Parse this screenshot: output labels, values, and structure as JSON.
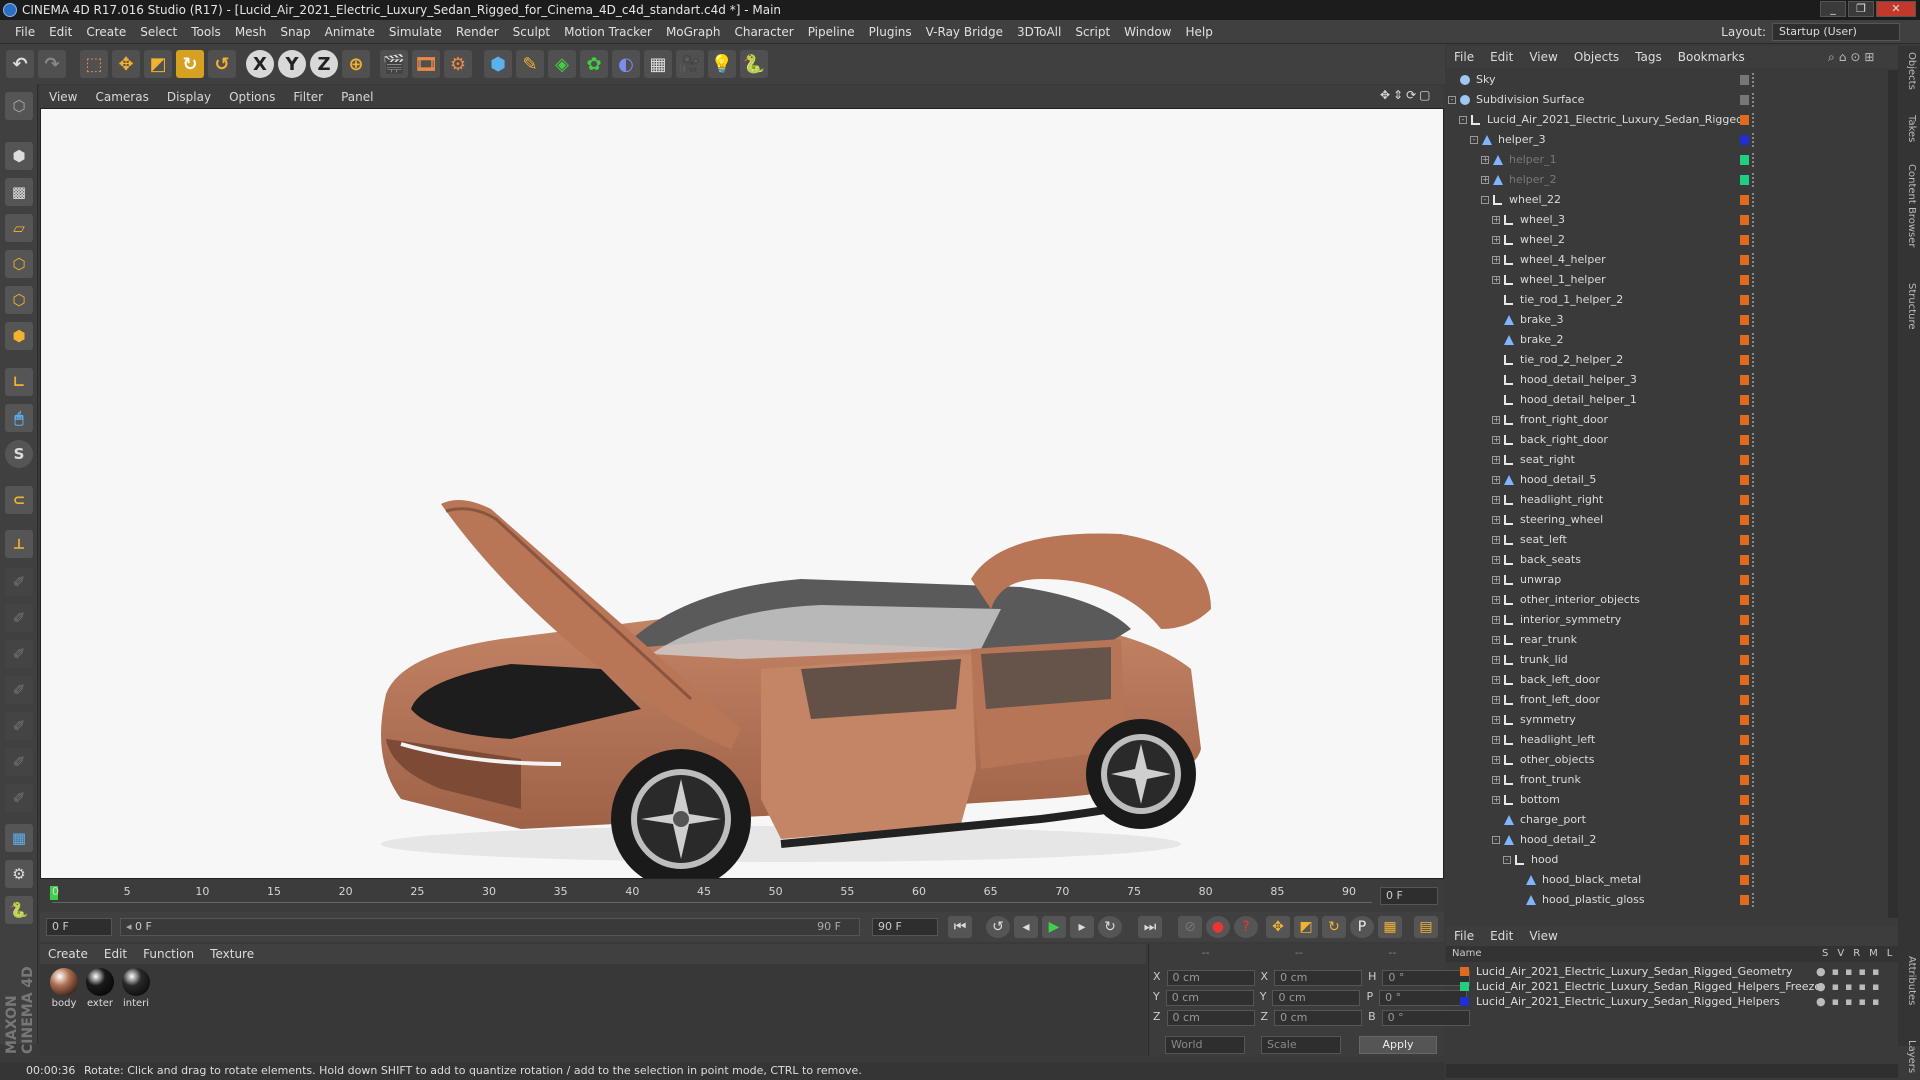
{
  "window": {
    "title": "CINEMA 4D R17.016 Studio (R17) - [Lucid_Air_2021_Electric_Luxury_Sedan_Rigged_for_Cinema_4D_c4d_standart.c4d *] - Main",
    "buttons": [
      "_",
      "❐",
      "✕"
    ]
  },
  "menubar": {
    "items": [
      "File",
      "Edit",
      "Create",
      "Select",
      "Tools",
      "Mesh",
      "Snap",
      "Animate",
      "Simulate",
      "Render",
      "Sculpt",
      "Motion Tracker",
      "MoGraph",
      "Character",
      "Pipeline",
      "Plugins",
      "V-Ray Bridge",
      "3DToAll",
      "Script",
      "Window",
      "Help"
    ],
    "layout_label": "Layout:",
    "layout_value": "Startup (User)"
  },
  "toolbar": {
    "axis_labels": [
      "X",
      "Y",
      "Z"
    ]
  },
  "viewport": {
    "menu": [
      "View",
      "Cameras",
      "Display",
      "Options",
      "Filter",
      "Panel"
    ]
  },
  "timeline": {
    "ticks": [
      "0",
      "5",
      "10",
      "15",
      "20",
      "25",
      "30",
      "35",
      "40",
      "45",
      "50",
      "55",
      "60",
      "65",
      "70",
      "75",
      "80",
      "85",
      "90"
    ],
    "end_frame_field": "0 F",
    "current_frame": "0 F",
    "range_start": "0 F",
    "range_end": "90 F",
    "max_frame": "90 F"
  },
  "materials": {
    "menu": [
      "Create",
      "Edit",
      "Function",
      "Texture"
    ],
    "items": [
      {
        "label": "body",
        "color": "#b07050"
      },
      {
        "label": "exter",
        "color": "#1a1a1a"
      },
      {
        "label": "interi",
        "color": "#2a2a2a"
      }
    ]
  },
  "coordinates": {
    "rows": [
      {
        "a": "X",
        "av": "0 cm",
        "b": "X",
        "bv": "0 cm",
        "c": "H",
        "cv": "0 °"
      },
      {
        "a": "Y",
        "av": "0 cm",
        "b": "Y",
        "bv": "0 cm",
        "c": "P",
        "cv": "0 °"
      },
      {
        "a": "Z",
        "av": "0 cm",
        "b": "Z",
        "bv": "0 cm",
        "c": "B",
        "cv": "0 °"
      }
    ],
    "headers": [
      "--",
      "--",
      "--"
    ],
    "mode1": "World",
    "mode2": "Scale",
    "apply": "Apply"
  },
  "status": {
    "time": "00:00:36",
    "message": "Rotate: Click and drag to rotate elements. Hold down SHIFT to add to quantize rotation / add to the selection in point mode, CTRL to remove."
  },
  "objects_panel": {
    "menu": [
      "File",
      "Edit",
      "View",
      "Objects",
      "Tags",
      "Bookmarks"
    ],
    "rows": [
      {
        "name": "Sky",
        "depth": 0,
        "icon": "sphere",
        "swatch": "#777777"
      },
      {
        "name": "Subdivision Surface",
        "depth": 0,
        "icon": "sphere",
        "swatch": "#777777",
        "exp": "-"
      },
      {
        "name": "Lucid_Air_2021_Electric_Luxury_Sedan_Rigged",
        "depth": 1,
        "icon": "null",
        "swatch": "#e06a20",
        "exp": "-"
      },
      {
        "name": "helper_3",
        "depth": 2,
        "icon": "tri",
        "swatch": "#2030d0",
        "exp": "-"
      },
      {
        "name": "helper_1",
        "depth": 3,
        "icon": "tri",
        "swatch": "#20d080",
        "exp": "+",
        "dim": true
      },
      {
        "name": "helper_2",
        "depth": 3,
        "icon": "tri",
        "swatch": "#20d080",
        "exp": "+",
        "dim": true
      },
      {
        "name": "wheel_22",
        "depth": 3,
        "icon": "null",
        "swatch": "#e06a20",
        "exp": "-"
      },
      {
        "name": "wheel_3",
        "depth": 4,
        "icon": "null",
        "swatch": "#e06a20",
        "exp": "+"
      },
      {
        "name": "wheel_2",
        "depth": 4,
        "icon": "null",
        "swatch": "#e06a20",
        "exp": "+"
      },
      {
        "name": "wheel_4_helper",
        "depth": 4,
        "icon": "null",
        "swatch": "#e06a20",
        "exp": "+"
      },
      {
        "name": "wheel_1_helper",
        "depth": 4,
        "icon": "null",
        "swatch": "#e06a20",
        "exp": "+"
      },
      {
        "name": "tie_rod_1_helper_2",
        "depth": 4,
        "icon": "null",
        "swatch": "#e06a20"
      },
      {
        "name": "brake_3",
        "depth": 4,
        "icon": "tri",
        "swatch": "#e06a20"
      },
      {
        "name": "brake_2",
        "depth": 4,
        "icon": "tri",
        "swatch": "#e06a20"
      },
      {
        "name": "tie_rod_2_helper_2",
        "depth": 4,
        "icon": "null",
        "swatch": "#e06a20"
      },
      {
        "name": "hood_detail_helper_3",
        "depth": 4,
        "icon": "null",
        "swatch": "#e06a20"
      },
      {
        "name": "hood_detail_helper_1",
        "depth": 4,
        "icon": "null",
        "swatch": "#e06a20"
      },
      {
        "name": "front_right_door",
        "depth": 4,
        "icon": "null",
        "swatch": "#e06a20",
        "exp": "+"
      },
      {
        "name": "back_right_door",
        "depth": 4,
        "icon": "null",
        "swatch": "#e06a20",
        "exp": "+"
      },
      {
        "name": "seat_right",
        "depth": 4,
        "icon": "null",
        "swatch": "#e06a20",
        "exp": "+"
      },
      {
        "name": "hood_detail_5",
        "depth": 4,
        "icon": "tri",
        "swatch": "#e06a20",
        "exp": "+"
      },
      {
        "name": "headlight_right",
        "depth": 4,
        "icon": "null",
        "swatch": "#e06a20",
        "exp": "+"
      },
      {
        "name": "steering_wheel",
        "depth": 4,
        "icon": "null",
        "swatch": "#e06a20",
        "exp": "+"
      },
      {
        "name": "seat_left",
        "depth": 4,
        "icon": "null",
        "swatch": "#e06a20",
        "exp": "+"
      },
      {
        "name": "back_seats",
        "depth": 4,
        "icon": "null",
        "swatch": "#e06a20",
        "exp": "+"
      },
      {
        "name": "unwrap",
        "depth": 4,
        "icon": "null",
        "swatch": "#e06a20",
        "exp": "+"
      },
      {
        "name": "other_interior_objects",
        "depth": 4,
        "icon": "null",
        "swatch": "#e06a20",
        "exp": "+"
      },
      {
        "name": "interior_symmetry",
        "depth": 4,
        "icon": "null",
        "swatch": "#e06a20",
        "exp": "+"
      },
      {
        "name": "rear_trunk",
        "depth": 4,
        "icon": "null",
        "swatch": "#e06a20",
        "exp": "+"
      },
      {
        "name": "trunk_lid",
        "depth": 4,
        "icon": "null",
        "swatch": "#e06a20",
        "exp": "+"
      },
      {
        "name": "back_left_door",
        "depth": 4,
        "icon": "null",
        "swatch": "#e06a20",
        "exp": "+"
      },
      {
        "name": "front_left_door",
        "depth": 4,
        "icon": "null",
        "swatch": "#e06a20",
        "exp": "+"
      },
      {
        "name": "symmetry",
        "depth": 4,
        "icon": "null",
        "swatch": "#e06a20",
        "exp": "+"
      },
      {
        "name": "headlight_left",
        "depth": 4,
        "icon": "null",
        "swatch": "#e06a20",
        "exp": "+"
      },
      {
        "name": "other_objects",
        "depth": 4,
        "icon": "null",
        "swatch": "#e06a20",
        "exp": "+"
      },
      {
        "name": "front_trunk",
        "depth": 4,
        "icon": "null",
        "swatch": "#e06a20",
        "exp": "+"
      },
      {
        "name": "bottom",
        "depth": 4,
        "icon": "null",
        "swatch": "#e06a20",
        "exp": "+"
      },
      {
        "name": "charge_port",
        "depth": 4,
        "icon": "tri",
        "swatch": "#e06a20"
      },
      {
        "name": "hood_detail_2",
        "depth": 4,
        "icon": "tri",
        "swatch": "#e06a20",
        "exp": "-"
      },
      {
        "name": "hood",
        "depth": 5,
        "icon": "null",
        "swatch": "#e06a20",
        "exp": "-"
      },
      {
        "name": "hood_black_metal",
        "depth": 6,
        "icon": "tri",
        "swatch": "#e06a20"
      },
      {
        "name": "hood_plastic_gloss",
        "depth": 6,
        "icon": "tri",
        "swatch": "#e06a20"
      }
    ]
  },
  "layers_panel": {
    "menu": [
      "File",
      "Edit",
      "View"
    ],
    "header_name": "Name",
    "header_cols": [
      "S",
      "V",
      "R",
      "M",
      "L"
    ],
    "rows": [
      {
        "name": "Lucid_Air_2021_Electric_Luxury_Sedan_Rigged_Geometry",
        "color": "#e06a20"
      },
      {
        "name": "Lucid_Air_2021_Electric_Luxury_Sedan_Rigged_Helpers_Freeze",
        "color": "#20d080"
      },
      {
        "name": "Lucid_Air_2021_Electric_Luxury_Sedan_Rigged_Helpers",
        "color": "#2030d0"
      }
    ]
  },
  "side_tabs": [
    "Objects",
    "Takes",
    "Content Browser",
    "Structure",
    "Attributes",
    "Layers"
  ],
  "brand": {
    "vertical_logo": "MAXON CINEMA 4D"
  }
}
